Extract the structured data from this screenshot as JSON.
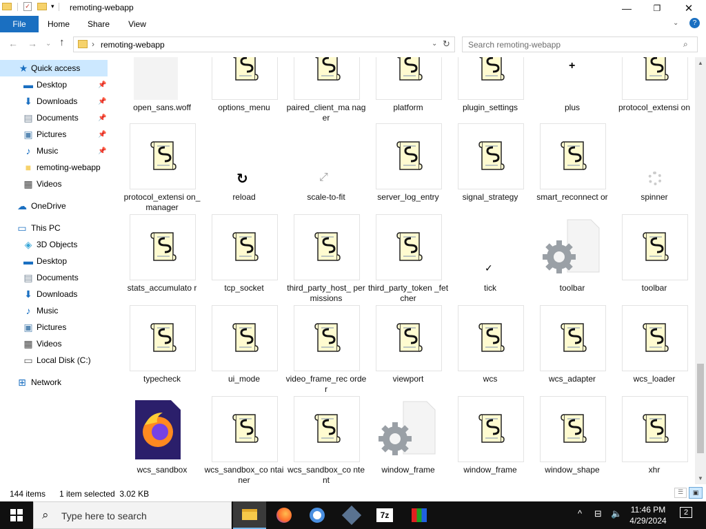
{
  "window": {
    "title": "remoting-webapp"
  },
  "ribbon": {
    "tabs": [
      "File",
      "Home",
      "Share",
      "View"
    ]
  },
  "address": {
    "path": "remoting-webapp",
    "search_placeholder": "Search remoting-webapp"
  },
  "sidebar": {
    "items": [
      {
        "label": "Quick access",
        "icon": "star-icon",
        "pinned": false
      },
      {
        "label": "Desktop",
        "icon": "desktop-icon",
        "pinned": true
      },
      {
        "label": "Downloads",
        "icon": "download-icon",
        "pinned": true
      },
      {
        "label": "Documents",
        "icon": "documents-icon",
        "pinned": true
      },
      {
        "label": "Pictures",
        "icon": "pictures-icon",
        "pinned": true
      },
      {
        "label": "Music",
        "icon": "music-icon",
        "pinned": true
      },
      {
        "label": "remoting-webapp",
        "icon": "folder-icon",
        "pinned": false
      },
      {
        "label": "Videos",
        "icon": "videos-icon",
        "pinned": false
      },
      {
        "label": "OneDrive",
        "icon": "onedrive-icon",
        "pinned": false
      },
      {
        "label": "This PC",
        "icon": "pc-icon",
        "pinned": false
      },
      {
        "label": "3D Objects",
        "icon": "3d-objects-icon",
        "pinned": false
      },
      {
        "label": "Desktop",
        "icon": "desktop-icon",
        "pinned": false
      },
      {
        "label": "Documents",
        "icon": "documents-icon",
        "pinned": false
      },
      {
        "label": "Downloads",
        "icon": "download-icon",
        "pinned": false
      },
      {
        "label": "Music",
        "icon": "music-icon",
        "pinned": false
      },
      {
        "label": "Pictures",
        "icon": "pictures-icon",
        "pinned": false
      },
      {
        "label": "Videos",
        "icon": "videos-icon",
        "pinned": false
      },
      {
        "label": "Local Disk (C:)",
        "icon": "disk-icon",
        "pinned": false
      },
      {
        "label": "Network",
        "icon": "network-icon",
        "pinned": false
      }
    ]
  },
  "files": [
    {
      "name": "open_sans.woff",
      "icon": "blank-file-icon"
    },
    {
      "name": "options_menu",
      "icon": "script-icon"
    },
    {
      "name": "paired_client_ma nager",
      "icon": "script-icon"
    },
    {
      "name": "platform",
      "icon": "script-icon"
    },
    {
      "name": "plugin_settings",
      "icon": "script-icon"
    },
    {
      "name": "plus",
      "icon": "plus-icon"
    },
    {
      "name": "protocol_extensi on",
      "icon": "script-icon"
    },
    {
      "name": "protocol_extensi on_manager",
      "icon": "script-icon"
    },
    {
      "name": "reload",
      "icon": "reload-icon"
    },
    {
      "name": "scale-to-fit",
      "icon": "scale-to-fit-icon"
    },
    {
      "name": "server_log_entry",
      "icon": "script-icon"
    },
    {
      "name": "signal_strategy",
      "icon": "script-icon"
    },
    {
      "name": "smart_reconnect or",
      "icon": "script-icon"
    },
    {
      "name": "spinner",
      "icon": "spinner-icon"
    },
    {
      "name": "stats_accumulato r",
      "icon": "script-icon"
    },
    {
      "name": "tcp_socket",
      "icon": "script-icon"
    },
    {
      "name": "third_party_host_ permissions",
      "icon": "script-icon"
    },
    {
      "name": "third_party_token _fetcher",
      "icon": "script-icon"
    },
    {
      "name": "tick",
      "icon": "tick-icon"
    },
    {
      "name": "toolbar",
      "icon": "settings-file-icon"
    },
    {
      "name": "toolbar",
      "icon": "script-icon"
    },
    {
      "name": "typecheck",
      "icon": "script-icon"
    },
    {
      "name": "ui_mode",
      "icon": "script-icon"
    },
    {
      "name": "video_frame_rec order",
      "icon": "script-icon"
    },
    {
      "name": "viewport",
      "icon": "script-icon"
    },
    {
      "name": "wcs",
      "icon": "script-icon"
    },
    {
      "name": "wcs_adapter",
      "icon": "script-icon"
    },
    {
      "name": "wcs_loader",
      "icon": "script-icon"
    },
    {
      "name": "wcs_sandbox",
      "icon": "firefox-file-icon"
    },
    {
      "name": "wcs_sandbox_co ntainer",
      "icon": "script-icon"
    },
    {
      "name": "wcs_sandbox_co ntent",
      "icon": "script-icon"
    },
    {
      "name": "window_frame",
      "icon": "settings-file-icon"
    },
    {
      "name": "window_frame",
      "icon": "script-icon"
    },
    {
      "name": "window_shape",
      "icon": "script-icon"
    },
    {
      "name": "xhr",
      "icon": "script-icon"
    }
  ],
  "status": {
    "item_count": "144 items",
    "selection": "1 item selected  3.02 KB"
  },
  "taskbar": {
    "search_placeholder": "Type here to search",
    "apps": [
      "file-explorer-icon",
      "firefox-icon",
      "chrome-icon",
      "virtualbox-icon",
      "7zip-icon",
      "app-icon"
    ],
    "time": "11:46 PM",
    "date": "4/29/2024",
    "notifications": "2"
  },
  "colors": {
    "accent": "#1a6fc1",
    "selection": "#cce8ff",
    "taskbar": "#101010"
  }
}
